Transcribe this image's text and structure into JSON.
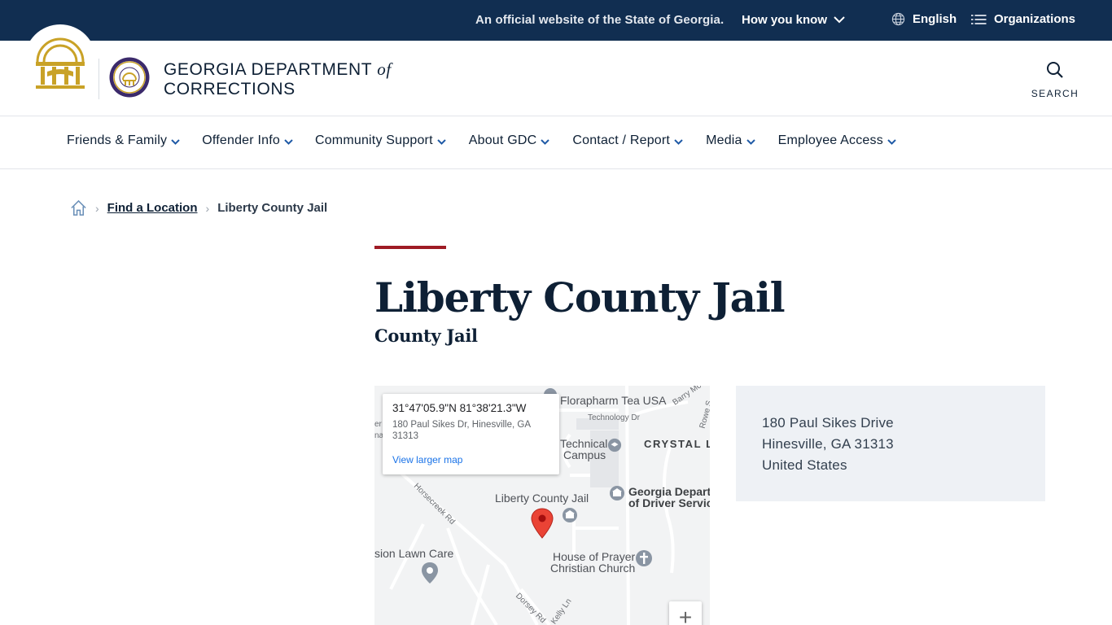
{
  "gov_banner": {
    "official_text": "An official website of the State of Georgia.",
    "how_you_know": "How you know",
    "language": "English",
    "organizations": "Organizations"
  },
  "header": {
    "agency_name_line1": "GEORGIA DEPARTMENT",
    "agency_name_of": "of",
    "agency_name_line2": "CORRECTIONS",
    "search_label": "SEARCH"
  },
  "nav": {
    "items": [
      {
        "label": "Friends & Family"
      },
      {
        "label": "Offender Info"
      },
      {
        "label": "Community Support"
      },
      {
        "label": "About GDC"
      },
      {
        "label": "Contact / Report"
      },
      {
        "label": "Media"
      },
      {
        "label": "Employee Access"
      }
    ]
  },
  "breadcrumb": {
    "parent": "Find a Location",
    "current": "Liberty County Jail"
  },
  "page": {
    "title": "Liberty County Jail",
    "subtitle": "County Jail"
  },
  "map": {
    "coords": "31°47'05.9\"N 81°38'21.3\"W",
    "address": "180 Paul Sikes Dr, Hinesville, GA 31313",
    "view_larger": "View larger map",
    "zoom_in": "+",
    "labels": {
      "florapharm": "Florapharm Tea USA",
      "technology_dr": "Technology Dr",
      "barry_mc": "Barry Mc",
      "rowe": "Rowe S",
      "technical": "Technical",
      "campus": "Campus",
      "crystal": "CRYSTAL L",
      "liberty_jail": "Liberty County Jail",
      "ga_dept_1": "Georgia Departm",
      "ga_dept_2": "of Driver Service",
      "horsecreek": "Horsecreek Rd",
      "lawn_care": "sion Lawn Care",
      "house_prayer_1": "House of Prayer",
      "house_prayer_2": "Christian Church",
      "dorsey": "Dorsey Rd",
      "kelly": "Kelly Ln",
      "left_cut_1": "er",
      "left_cut_2": "na"
    }
  },
  "address_card": {
    "street": "180 Paul Sikes Drive",
    "city_state_zip": "Hinesville, GA 31313",
    "country": "United States"
  },
  "colors": {
    "banner_bg": "#112e51",
    "accent_red": "#9e1b24",
    "gold": "#c9a227",
    "navy_text": "#0e2035",
    "address_card_bg": "#eef1f5"
  }
}
